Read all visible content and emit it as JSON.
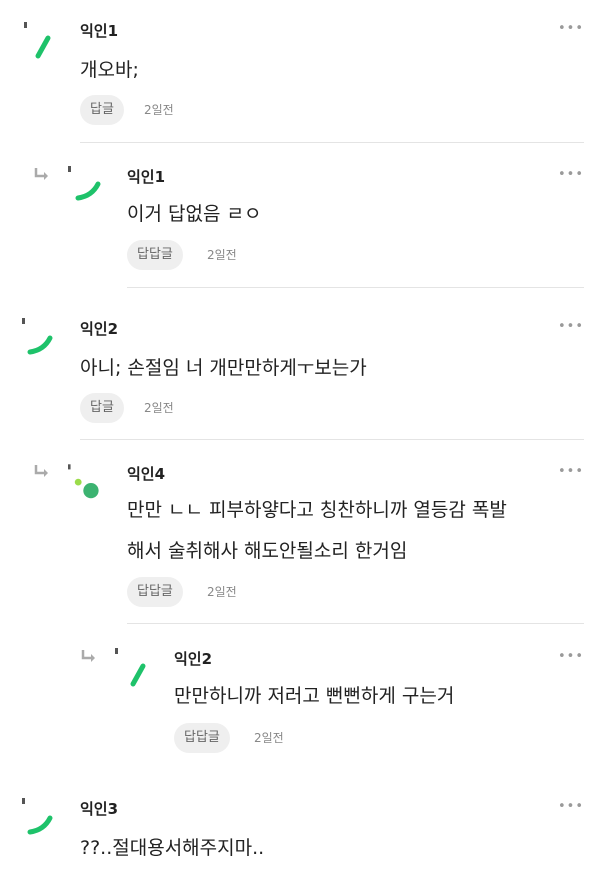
{
  "colors": {
    "accent": "#1ec26a",
    "accent_light": "#9bdc4a"
  },
  "comments": [
    {
      "name": "익인1",
      "text": "개오바;",
      "reply_label": "답글",
      "time": "2일전",
      "avatar_icon": "green-slash-icon"
    },
    {
      "name": "익인1",
      "text": "이거 답없음 ㄹㅇ",
      "reply_label": "답답글",
      "time": "2일전",
      "avatar_icon": "green-curve-icon"
    },
    {
      "name": "익인2",
      "text": "아니; 손절임 너 개만만하게ㅜ보는가",
      "reply_label": "답글",
      "time": "2일전",
      "avatar_icon": "green-curve-icon"
    },
    {
      "name": "익인4",
      "text_lines": [
        "만만 ㄴㄴ 피부하얗다고 칭찬하니까 열등감 폭발",
        "해서 술취해사 해도안될소리 한거임"
      ],
      "reply_label": "답답글",
      "time": "2일전",
      "avatar_icon": "green-dots-icon"
    },
    {
      "name": "익인2",
      "text": "만만하니까 저러고 뻔뻔하게 구는거",
      "reply_label": "답답글",
      "time": "2일전",
      "avatar_icon": "green-slash-icon"
    },
    {
      "name": "익인3",
      "text": "??..절대용서해주지마..",
      "avatar_icon": "green-curve-icon"
    }
  ],
  "more_icon": "more-dots-icon",
  "more_label": "•••"
}
